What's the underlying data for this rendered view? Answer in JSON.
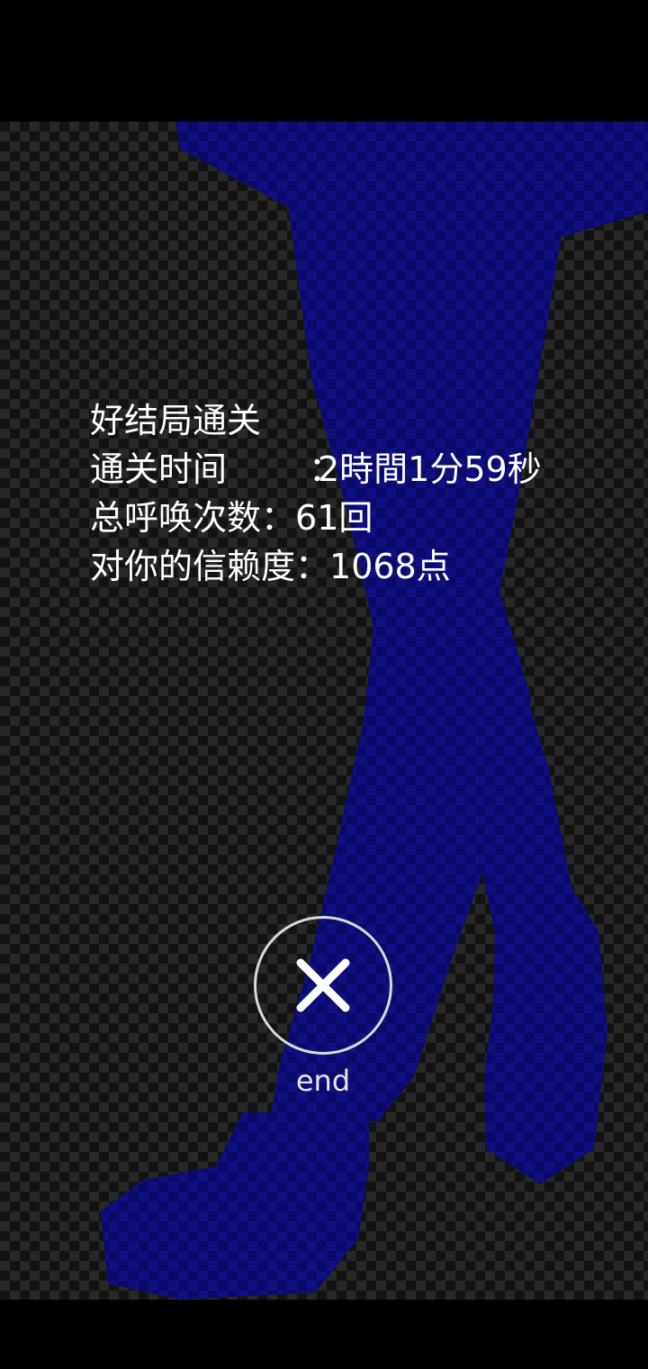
{
  "result": {
    "title": "好结局通关",
    "rows": [
      {
        "label": "通关时间",
        "sep": "：",
        "value": "2時間1分59秒"
      },
      {
        "label": "总呼唤次数",
        "sep": "：",
        "value": "61回"
      },
      {
        "label": "对你的信赖度",
        "sep": "：",
        "value": "1068点"
      }
    ]
  },
  "end_button": {
    "icon": "close-icon",
    "label": "end"
  },
  "colors": {
    "background": "#000000",
    "silhouette": "#0c0a6e",
    "text": "#ffffff",
    "button_ring": "#d9d9d9"
  }
}
